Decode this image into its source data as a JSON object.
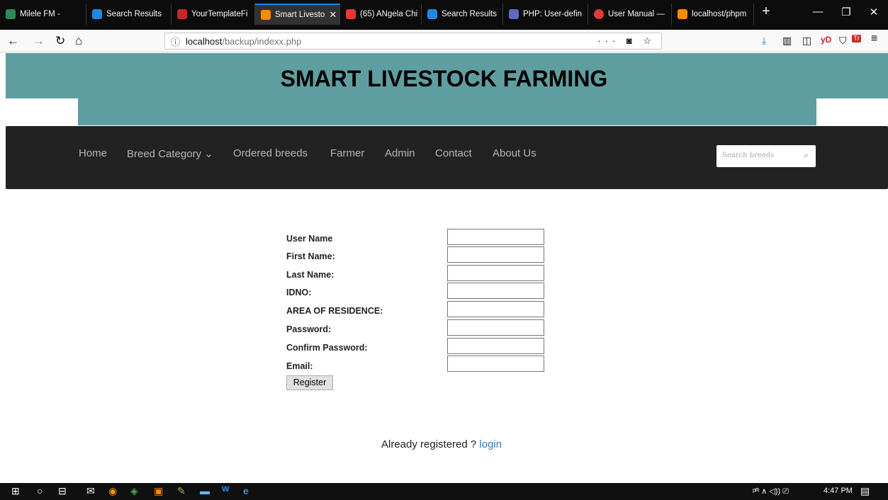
{
  "browser": {
    "tabs": [
      {
        "label": "Milele FM - ",
        "icon_color": "#2e8b57"
      },
      {
        "label": "Search Results",
        "icon_color": "#1e88e5"
      },
      {
        "label": "YourTemplateFi",
        "icon_color": "#c62828"
      },
      {
        "label": "Smart Livesto",
        "icon_color": "#fb8c00"
      },
      {
        "label": "(65) ANgela Chi",
        "icon_color": "#e53935"
      },
      {
        "label": "Search Results",
        "icon_color": "#1e88e5"
      },
      {
        "label": "PHP: User-defin",
        "icon_color": "#5c6bc0"
      },
      {
        "label": "User Manual —",
        "icon_color": "#e53935"
      },
      {
        "label": "localhost/phpm",
        "icon_color": "#fb8c00"
      }
    ],
    "active_tab_close": "✕",
    "new_tab": "+",
    "window_controls": {
      "minimize": "—",
      "maximize": "❐",
      "close": "✕"
    },
    "nav": {
      "back": "←",
      "forward": "→",
      "reload": "↻",
      "home": "⌂"
    },
    "url": {
      "info_icon": "ⓘ",
      "host": "localhost",
      "path": "/backup/indexx.php",
      "actions": "··· ◙ ☆"
    },
    "toolbar": {
      "download": "⤓",
      "library": "▥",
      "sidebar": "◫",
      "yd": "yD",
      "shield": "⛉",
      "ext": "Tr",
      "menu": "≡"
    }
  },
  "site": {
    "title": "SMART LIVESTOCK FARMING",
    "header_color": "#5f9ea0",
    "menu": [
      {
        "label": "Home"
      },
      {
        "label": "Breed Category ⌄"
      },
      {
        "label": "Ordered breeds"
      },
      {
        "label": "Farmer"
      },
      {
        "label": "Admin"
      },
      {
        "label": "Contact"
      },
      {
        "label": "About Us"
      }
    ],
    "search": {
      "placeholder": "Search breeds",
      "icon": "⌕"
    }
  },
  "form": {
    "fields": [
      {
        "label": "User Name",
        "value": ""
      },
      {
        "label": "First Name:",
        "value": ""
      },
      {
        "label": "Last Name:",
        "value": ""
      },
      {
        "label": "IDNO:",
        "value": ""
      },
      {
        "label": "AREA OF RESIDENCE:",
        "value": ""
      },
      {
        "label": "Password:",
        "value": ""
      },
      {
        "label": "Confirm Password:",
        "value": ""
      },
      {
        "label": "Email:",
        "value": ""
      }
    ],
    "submit_label": "Register",
    "login_prompt": "Already registered ? ",
    "login_link": "login"
  },
  "taskbar": {
    "icons": [
      "⊞",
      "○",
      "⊟",
      "✉",
      "◉",
      "◈",
      "▣",
      "✎",
      "▬",
      "W",
      "e"
    ],
    "tray": "ᵖᴿ  ∧  ◁))  ⎚",
    "time": "4:47 PM",
    "notification_icon": "▤"
  }
}
